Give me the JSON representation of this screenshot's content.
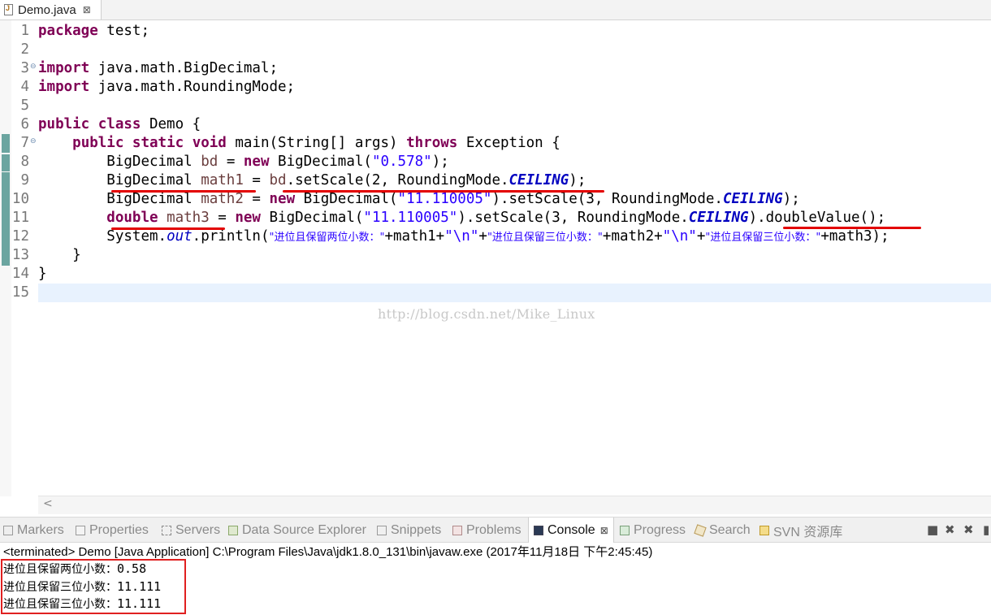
{
  "editor_tab": {
    "label": "Demo.java",
    "close": "⊠"
  },
  "code": {
    "l1": {
      "kw": "package",
      "rest": " test;"
    },
    "l3": {
      "kw": "import",
      "rest": " java.math.BigDecimal;"
    },
    "l4": {
      "kw": "import",
      "rest": " java.math.RoundingMode;"
    },
    "l6": {
      "kw1": "public",
      "kw2": "class",
      "rest": " Demo {"
    },
    "l7": {
      "kw1": "public",
      "kw2": "static",
      "kw3": "void",
      "mid": " main(String[] args) ",
      "kw4": "throws",
      "rest": " Exception {"
    },
    "l8": {
      "a": "BigDecimal ",
      "v": "bd",
      "b": " = ",
      "kw": "new",
      "c": " BigDecimal(",
      "s": "\"0.578\"",
      "d": ");"
    },
    "l9": {
      "a": "BigDecimal ",
      "v": "math1",
      "b": " = ",
      "v2": "bd",
      "c": ".setScale(2, RoundingMode.",
      "k": "CEILING",
      "d": ");"
    },
    "l10": {
      "a": "BigDecimal ",
      "v": "math2",
      "b": " = ",
      "kw": "new",
      "c": " BigDecimal(",
      "s": "\"11.110005\"",
      "d": ").setScale(3, RoundingMode.",
      "k": "CEILING",
      "e": ");"
    },
    "l11": {
      "kw1": "double",
      "sp": " ",
      "v": "math3",
      "b": " = ",
      "kw": "new",
      "c": " BigDecimal(",
      "s": "\"11.110005\"",
      "d": ").setScale(3, RoundingMode.",
      "k": "CEILING",
      "e": ").doubleValue();"
    },
    "l12": {
      "a": "System.",
      "f": "out",
      "b": ".println(",
      "s1": "\"进位且保留两位小数：\"",
      "p1": "+math1+",
      "s2": "\"\\n\"",
      "p2": "+",
      "s3": "\"进位且保留三位小数：\"",
      "p3": "+math2+",
      "s4": "\"\\n\"",
      "p4": "+",
      "s5": "\"进位且保留三位小数：\"",
      "p5": "+math3);"
    },
    "l13": "    }",
    "l14": "}"
  },
  "line_numbers": [
    "1",
    "2",
    "3",
    "4",
    "5",
    "6",
    "7",
    "8",
    "9",
    "10",
    "11",
    "12",
    "13",
    "14",
    "15"
  ],
  "fold_marker": "⊖",
  "watermark": "http://blog.csdn.net/Mike_Linux",
  "scroll_arrow": "<",
  "views": [
    {
      "label": "Markers"
    },
    {
      "label": "Properties"
    },
    {
      "label": "Servers"
    },
    {
      "label": "Data Source Explorer"
    },
    {
      "label": "Snippets"
    },
    {
      "label": "Problems"
    },
    {
      "label": "Console",
      "active": true,
      "close": "⊠"
    },
    {
      "label": "Progress"
    },
    {
      "label": "Search"
    },
    {
      "label": "SVN 资源库"
    }
  ],
  "console": {
    "header": "<terminated> Demo [Java Application] C:\\Program Files\\Java\\jdk1.8.0_131\\bin\\javaw.exe (2017年11月18日 下午2:45:45)",
    "output": [
      {
        "label": "进位且保留两位小数：",
        "value": "0.58"
      },
      {
        "label": "进位且保留三位小数：",
        "value": "11.111"
      },
      {
        "label": "进位且保留三位小数：",
        "value": "11.111"
      }
    ]
  },
  "colors": {
    "keyword": "#7f0055",
    "string": "#2a00ff",
    "constant": "#0000c0",
    "annotation_red": "#e30000",
    "change_bar": "#6ba5a0"
  }
}
